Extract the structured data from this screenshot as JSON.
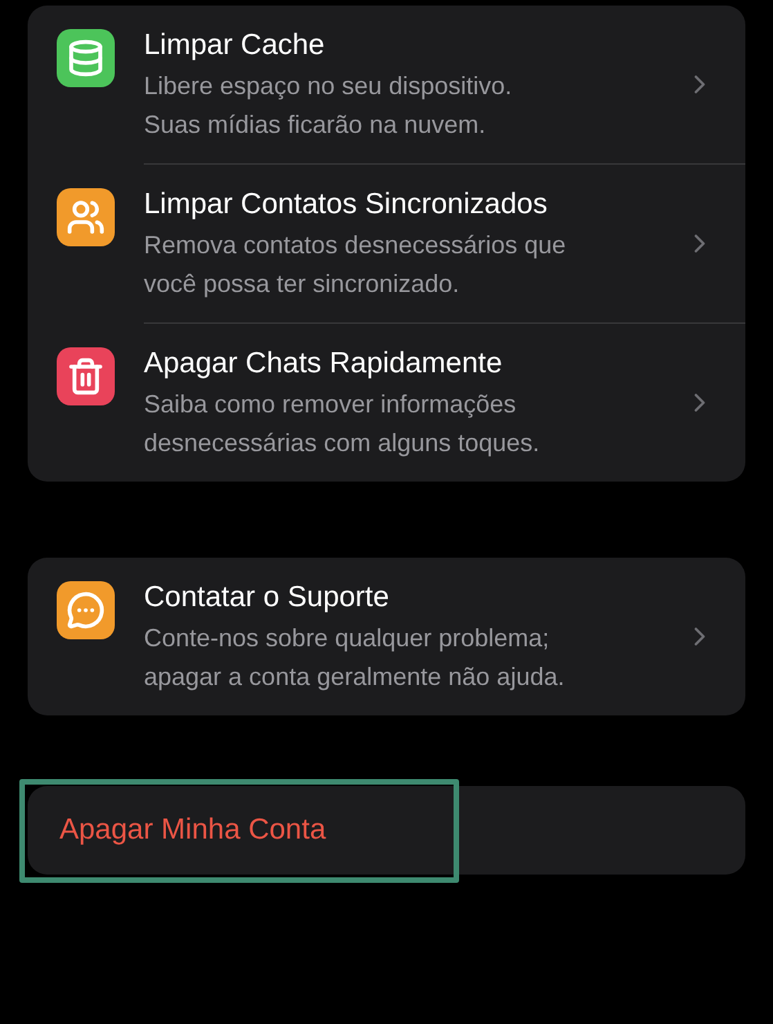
{
  "groups": [
    {
      "items": [
        {
          "kind": "database",
          "color": "#4cc45a",
          "title": "Limpar Cache",
          "subtitle": [
            "Libere espaço no seu dispositivo.",
            "Suas mídias ficarão na nuvem."
          ]
        },
        {
          "kind": "users",
          "color": "#f19a2b",
          "title": "Limpar Contatos Sincronizados",
          "subtitle": [
            "Remova contatos desnecessários que",
            "você possa ter sincronizado."
          ]
        },
        {
          "kind": "trash",
          "color": "#e9435a",
          "title": "Apagar Chats Rapidamente",
          "subtitle": [
            "Saiba como remover informações",
            "desnecessárias com alguns toques."
          ]
        }
      ]
    },
    {
      "items": [
        {
          "kind": "chat",
          "color": "#f19a2b",
          "title": "Contatar o Suporte",
          "subtitle": [
            "Conte-nos sobre qualquer problema;",
            "apagar a conta geralmente não ajuda."
          ]
        }
      ]
    }
  ],
  "danger_button": {
    "label": "Apagar Minha Conta",
    "highlighted": true
  }
}
